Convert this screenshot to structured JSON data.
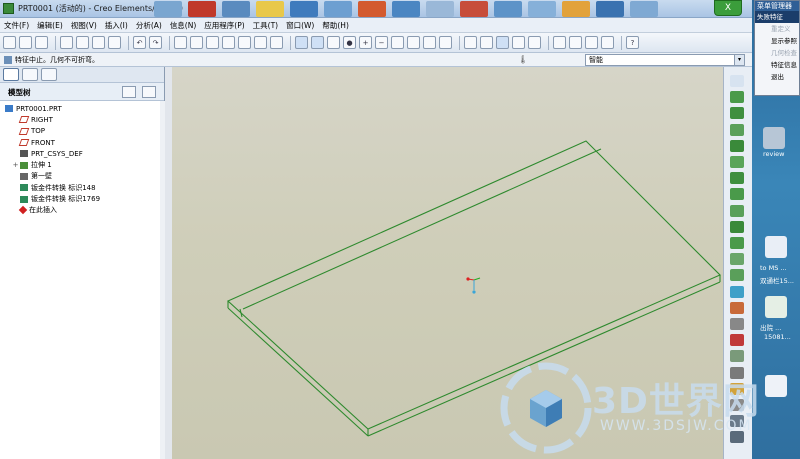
{
  "window": {
    "title": "PRT0001 (活动的) - Creo Elements/Pro 5.0",
    "close_glyph": "X"
  },
  "menubar": [
    "文件(F)",
    "编辑(E)",
    "视图(V)",
    "插入(I)",
    "分析(A)",
    "信息(N)",
    "应用程序(P)",
    "工具(T)",
    "窗口(W)",
    "帮助(H)"
  ],
  "message": {
    "text": "特征中止。几何不可折弯。",
    "filter_value": "智能",
    "filter_arrow": "▾"
  },
  "model_tree": {
    "header": "模型树",
    "nodes": [
      {
        "label": "PRT0001.PRT",
        "icon": "part-icon",
        "expand": ""
      },
      {
        "label": "RIGHT",
        "icon": "datum-plane-icon",
        "expand": ""
      },
      {
        "label": "TOP",
        "icon": "datum-plane-icon",
        "expand": ""
      },
      {
        "label": "FRONT",
        "icon": "datum-plane-icon",
        "expand": ""
      },
      {
        "label": "PRT_CSYS_DEF",
        "icon": "csys-icon",
        "expand": ""
      },
      {
        "label": "拉伸 1",
        "icon": "extrude-icon",
        "expand": "+"
      },
      {
        "label": "第一壁",
        "icon": "wall-icon",
        "expand": ""
      },
      {
        "label": "钣金件转换 标识148",
        "icon": "sheetmetal-convert-icon",
        "expand": ""
      },
      {
        "label": "钣金件转换 标识1769",
        "icon": "sheetmetal-convert-icon",
        "expand": ""
      },
      {
        "label": "在此插入",
        "icon": "insert-here-icon",
        "expand": ""
      }
    ]
  },
  "popup_menu": {
    "header": "菜单管理器",
    "items": [
      {
        "label": "失败特征",
        "state": "selected"
      },
      {
        "label": "重定义",
        "state": "disabled"
      },
      {
        "label": "显示参照",
        "state": "normal"
      },
      {
        "label": "几何检查",
        "state": "disabled"
      },
      {
        "label": "特征信息",
        "state": "normal"
      },
      {
        "label": "退出",
        "state": "normal"
      }
    ]
  },
  "desktop": {
    "icons": [
      {
        "label": "review",
        "name": "review-icon"
      },
      {
        "label": "to MS ...",
        "name": "word-doc-icon"
      },
      {
        "label": "双通栏15...",
        "name": "word-doc-icon"
      },
      {
        "label": "出院 ...",
        "name": "excel-doc-icon"
      },
      {
        "label": "15081...",
        "name": "doc-icon"
      }
    ]
  },
  "watermark": {
    "title": "3D世界网",
    "url": "WWW.3DSJW.COM"
  },
  "colors": {
    "model_edge": "#2e8a2e",
    "viewport_bg": "#d2d1bf",
    "accent": "#2f5f96"
  }
}
